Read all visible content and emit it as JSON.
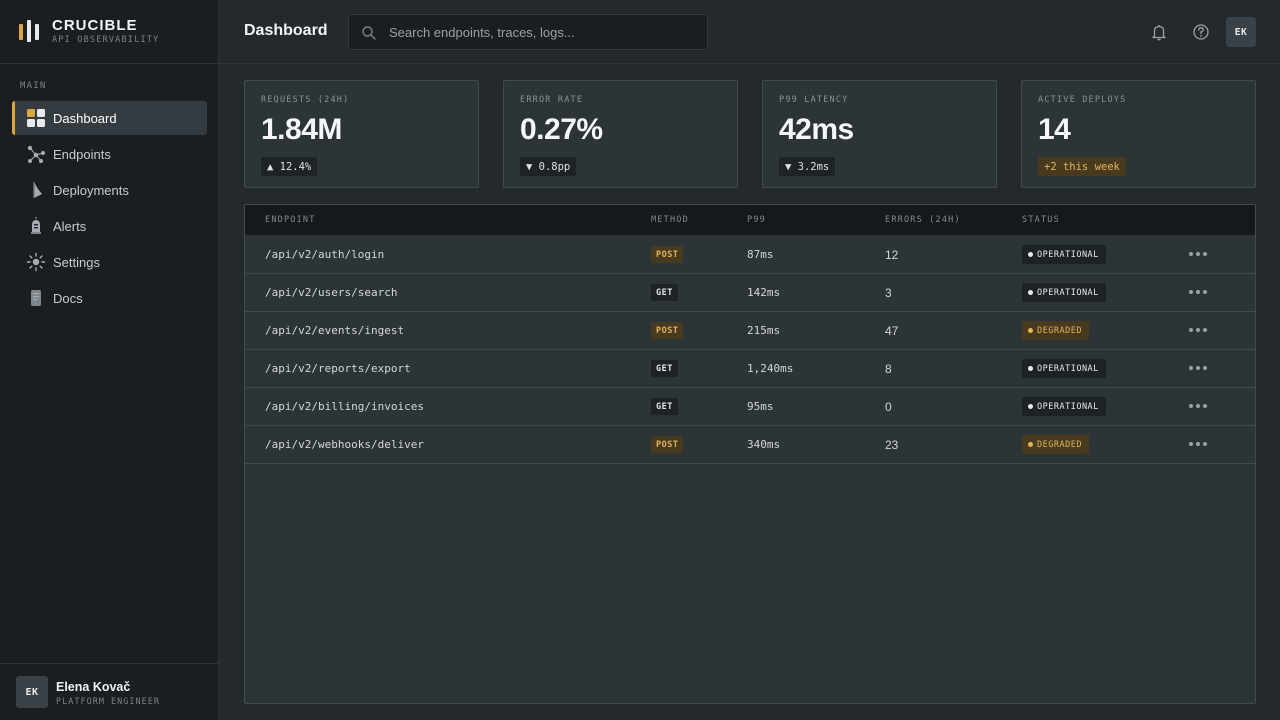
{
  "brand": {
    "name": "CRUCIBLE",
    "tagline": "API OBSERVABILITY"
  },
  "sidebar": {
    "section_label": "MAIN",
    "items": [
      {
        "label": "Dashboard",
        "icon": "dashboard-grid-icon",
        "active": true
      },
      {
        "label": "Endpoints",
        "icon": "endpoints-network-icon"
      },
      {
        "label": "Deployments",
        "icon": "deployments-flag-icon"
      },
      {
        "label": "Alerts",
        "icon": "alerts-siren-icon"
      },
      {
        "label": "Settings",
        "icon": "settings-gear-icon"
      },
      {
        "label": "Docs",
        "icon": "docs-file-icon"
      }
    ]
  },
  "user": {
    "initials": "EK",
    "name": "Elena Kovač",
    "role": "PLATFORM ENGINEER"
  },
  "header": {
    "title": "Dashboard",
    "search_placeholder": "Search endpoints, traces, logs...",
    "avatar_initials": "EK"
  },
  "kpis": [
    {
      "label": "REQUESTS (24H)",
      "value": "1.84M",
      "delta": "▲ 12.4%",
      "accent": false
    },
    {
      "label": "ERROR RATE",
      "value": "0.27%",
      "delta": "▼ 0.8pp",
      "accent": false
    },
    {
      "label": "P99 LATENCY",
      "value": "42ms",
      "delta": "▼ 3.2ms",
      "accent": false
    },
    {
      "label": "ACTIVE DEPLOYS",
      "value": "14",
      "delta": "+2 this week",
      "accent": true
    }
  ],
  "table": {
    "columns": [
      "ENDPOINT",
      "METHOD",
      "P99",
      "ERRORS (24H)",
      "STATUS"
    ],
    "rows": [
      {
        "endpoint": "/api/v2/auth/login",
        "method": "POST",
        "p99": "87ms",
        "errors": "12",
        "status": "OPERATIONAL"
      },
      {
        "endpoint": "/api/v2/users/search",
        "method": "GET",
        "p99": "142ms",
        "errors": "3",
        "status": "OPERATIONAL"
      },
      {
        "endpoint": "/api/v2/events/ingest",
        "method": "POST",
        "p99": "215ms",
        "errors": "47",
        "status": "DEGRADED"
      },
      {
        "endpoint": "/api/v2/reports/export",
        "method": "GET",
        "p99": "1,240ms",
        "errors": "8",
        "status": "OPERATIONAL"
      },
      {
        "endpoint": "/api/v2/billing/invoices",
        "method": "GET",
        "p99": "95ms",
        "errors": "0",
        "status": "OPERATIONAL"
      },
      {
        "endpoint": "/api/v2/webhooks/deliver",
        "method": "POST",
        "p99": "340ms",
        "errors": "23",
        "status": "DEGRADED"
      }
    ]
  },
  "colors": {
    "accent": "#d9a63f",
    "background": "#24292d",
    "sidebar": "#1b1e21",
    "card": "#2d3438"
  }
}
